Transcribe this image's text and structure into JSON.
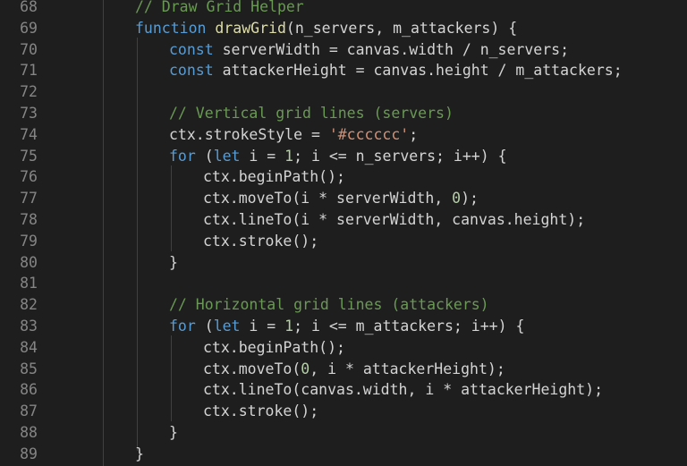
{
  "editor": {
    "lines": [
      {
        "number": "68",
        "indent": 0,
        "tokens": [
          {
            "t": "// Draw Grid Helper",
            "c": "cm"
          }
        ]
      },
      {
        "number": "69",
        "indent": 0,
        "tokens": [
          {
            "t": "function ",
            "c": "kw"
          },
          {
            "t": "drawGrid",
            "c": "fn"
          },
          {
            "t": "(n_servers, m_attackers) {",
            "c": "txt"
          }
        ]
      },
      {
        "number": "70",
        "indent": 1,
        "tokens": [
          {
            "t": "const ",
            "c": "kw"
          },
          {
            "t": "serverWidth = canvas.width / n_servers;",
            "c": "txt"
          }
        ]
      },
      {
        "number": "71",
        "indent": 1,
        "tokens": [
          {
            "t": "const ",
            "c": "kw"
          },
          {
            "t": "attackerHeight = canvas.height / m_attackers;",
            "c": "txt"
          }
        ]
      },
      {
        "number": "72",
        "indent": 1,
        "tokens": []
      },
      {
        "number": "73",
        "indent": 1,
        "tokens": [
          {
            "t": "// Vertical grid lines (servers)",
            "c": "cm"
          }
        ]
      },
      {
        "number": "74",
        "indent": 1,
        "tokens": [
          {
            "t": "ctx.strokeStyle = ",
            "c": "txt"
          },
          {
            "t": "'#cccccc'",
            "c": "str"
          },
          {
            "t": ";",
            "c": "txt"
          }
        ]
      },
      {
        "number": "75",
        "indent": 1,
        "tokens": [
          {
            "t": "for",
            "c": "kw"
          },
          {
            "t": " (",
            "c": "txt"
          },
          {
            "t": "let",
            "c": "kw"
          },
          {
            "t": " i = ",
            "c": "txt"
          },
          {
            "t": "1",
            "c": "num"
          },
          {
            "t": "; i <= n_servers; i++) {",
            "c": "txt"
          }
        ]
      },
      {
        "number": "76",
        "indent": 2,
        "tokens": [
          {
            "t": "ctx.beginPath();",
            "c": "txt"
          }
        ]
      },
      {
        "number": "77",
        "indent": 2,
        "tokens": [
          {
            "t": "ctx.moveTo(i * serverWidth, ",
            "c": "txt"
          },
          {
            "t": "0",
            "c": "num"
          },
          {
            "t": ");",
            "c": "txt"
          }
        ]
      },
      {
        "number": "78",
        "indent": 2,
        "tokens": [
          {
            "t": "ctx.lineTo(i * serverWidth, canvas.height);",
            "c": "txt"
          }
        ]
      },
      {
        "number": "79",
        "indent": 2,
        "tokens": [
          {
            "t": "ctx.stroke();",
            "c": "txt"
          }
        ]
      },
      {
        "number": "80",
        "indent": 1,
        "tokens": [
          {
            "t": "}",
            "c": "txt"
          }
        ]
      },
      {
        "number": "81",
        "indent": 1,
        "tokens": []
      },
      {
        "number": "82",
        "indent": 1,
        "tokens": [
          {
            "t": "// Horizontal grid lines (attackers)",
            "c": "cm"
          }
        ]
      },
      {
        "number": "83",
        "indent": 1,
        "tokens": [
          {
            "t": "for",
            "c": "kw"
          },
          {
            "t": " (",
            "c": "txt"
          },
          {
            "t": "let",
            "c": "kw"
          },
          {
            "t": " i = ",
            "c": "txt"
          },
          {
            "t": "1",
            "c": "num"
          },
          {
            "t": "; i <= m_attackers; i++) {",
            "c": "txt"
          }
        ]
      },
      {
        "number": "84",
        "indent": 2,
        "tokens": [
          {
            "t": "ctx.beginPath();",
            "c": "txt"
          }
        ]
      },
      {
        "number": "85",
        "indent": 2,
        "tokens": [
          {
            "t": "ctx.moveTo(",
            "c": "txt"
          },
          {
            "t": "0",
            "c": "num"
          },
          {
            "t": ", i * attackerHeight);",
            "c": "txt"
          }
        ]
      },
      {
        "number": "86",
        "indent": 2,
        "tokens": [
          {
            "t": "ctx.lineTo(canvas.width, i * attackerHeight);",
            "c": "txt"
          }
        ]
      },
      {
        "number": "87",
        "indent": 2,
        "tokens": [
          {
            "t": "ctx.stroke();",
            "c": "txt"
          }
        ]
      },
      {
        "number": "88",
        "indent": 1,
        "tokens": [
          {
            "t": "}",
            "c": "txt"
          }
        ]
      },
      {
        "number": "89",
        "indent": 0,
        "tokens": [
          {
            "t": "}",
            "c": "txt"
          }
        ]
      }
    ]
  },
  "colors": {
    "background": "#1e1e1e",
    "line_number": "#858585",
    "keyword": "#569cd6",
    "function": "#dcdcaa",
    "comment": "#6a9955",
    "string": "#ce9178",
    "number": "#b5cea8",
    "text": "#d4d4d4",
    "indent_guide": "#404040"
  }
}
